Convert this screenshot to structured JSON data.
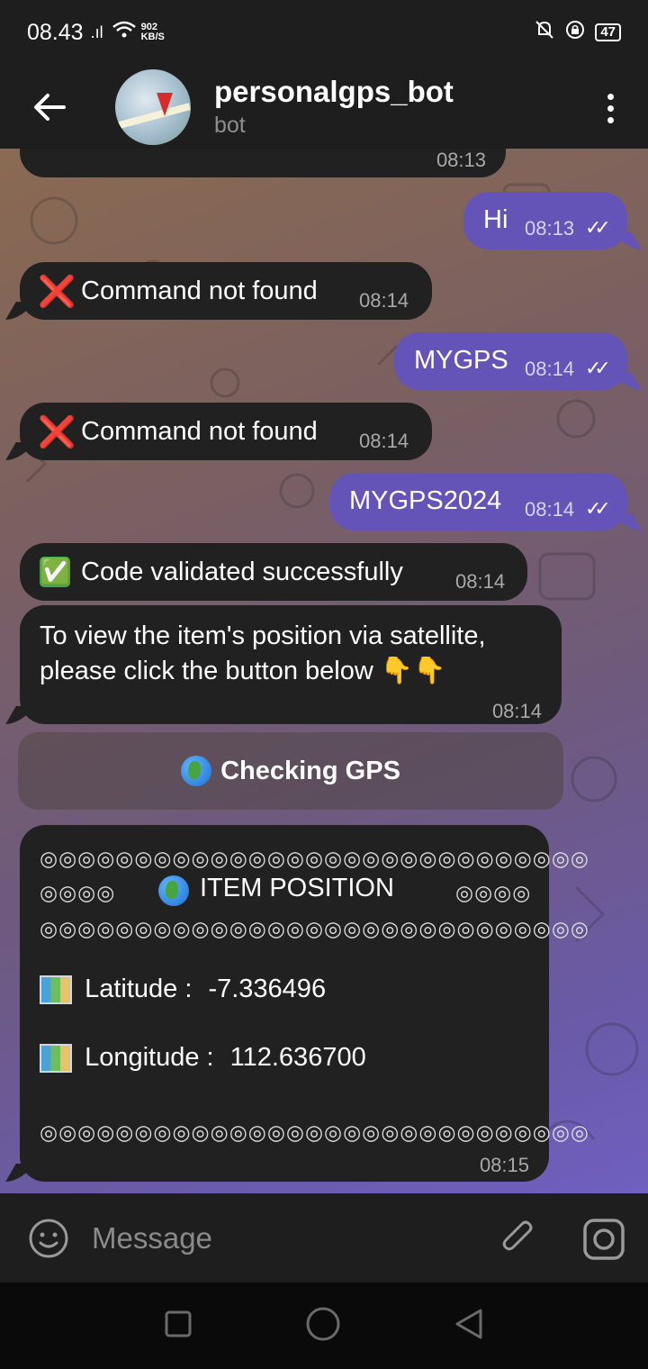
{
  "status_bar": {
    "time": "08.43",
    "signal": ".ıl",
    "speed_value": "902",
    "speed_unit": "KB/S",
    "battery": "47"
  },
  "header": {
    "title": "personalgps_bot",
    "subtitle": "bot"
  },
  "messages": [
    {
      "id": "m0",
      "direction": "in",
      "text": "",
      "time": "08:13"
    },
    {
      "id": "m1",
      "direction": "out",
      "text": "Hi",
      "time": "08:13"
    },
    {
      "id": "m2",
      "direction": "in",
      "emoji": "❌",
      "text": "Command not found",
      "time": "08:14"
    },
    {
      "id": "m3",
      "direction": "out",
      "text": "MYGPS",
      "time": "08:14"
    },
    {
      "id": "m4",
      "direction": "in",
      "emoji": "❌",
      "text": "Command not found",
      "time": "08:14"
    },
    {
      "id": "m5",
      "direction": "out",
      "text": "MYGPS2024",
      "time": "08:14"
    },
    {
      "id": "m6",
      "direction": "in",
      "emoji": "✅",
      "text": "Code validated successfully",
      "time": "08:14"
    },
    {
      "id": "m7",
      "direction": "in",
      "text_line1": "To view the item's position via satellite,",
      "text_line2": "please click the button below 👇👇",
      "time": "08:14"
    },
    {
      "id": "m8",
      "direction": "in",
      "border_line": "◎◎◎◎◎◎◎◎◎◎◎◎◎◎◎◎◎◎◎◎◎◎◎◎◎◎◎◎◎",
      "side_marks": "◎◎◎◎",
      "heading": "ITEM POSITION",
      "latitude_label": "Latitude :",
      "latitude_value": "-7.336496",
      "longitude_label": "Longitude :",
      "longitude_value": "112.636700",
      "time": "08:15"
    }
  ],
  "inline_button": {
    "label": "Checking GPS",
    "icon": "globe-icon"
  },
  "input_bar": {
    "placeholder": "Message"
  },
  "read_checks": "✓✓"
}
